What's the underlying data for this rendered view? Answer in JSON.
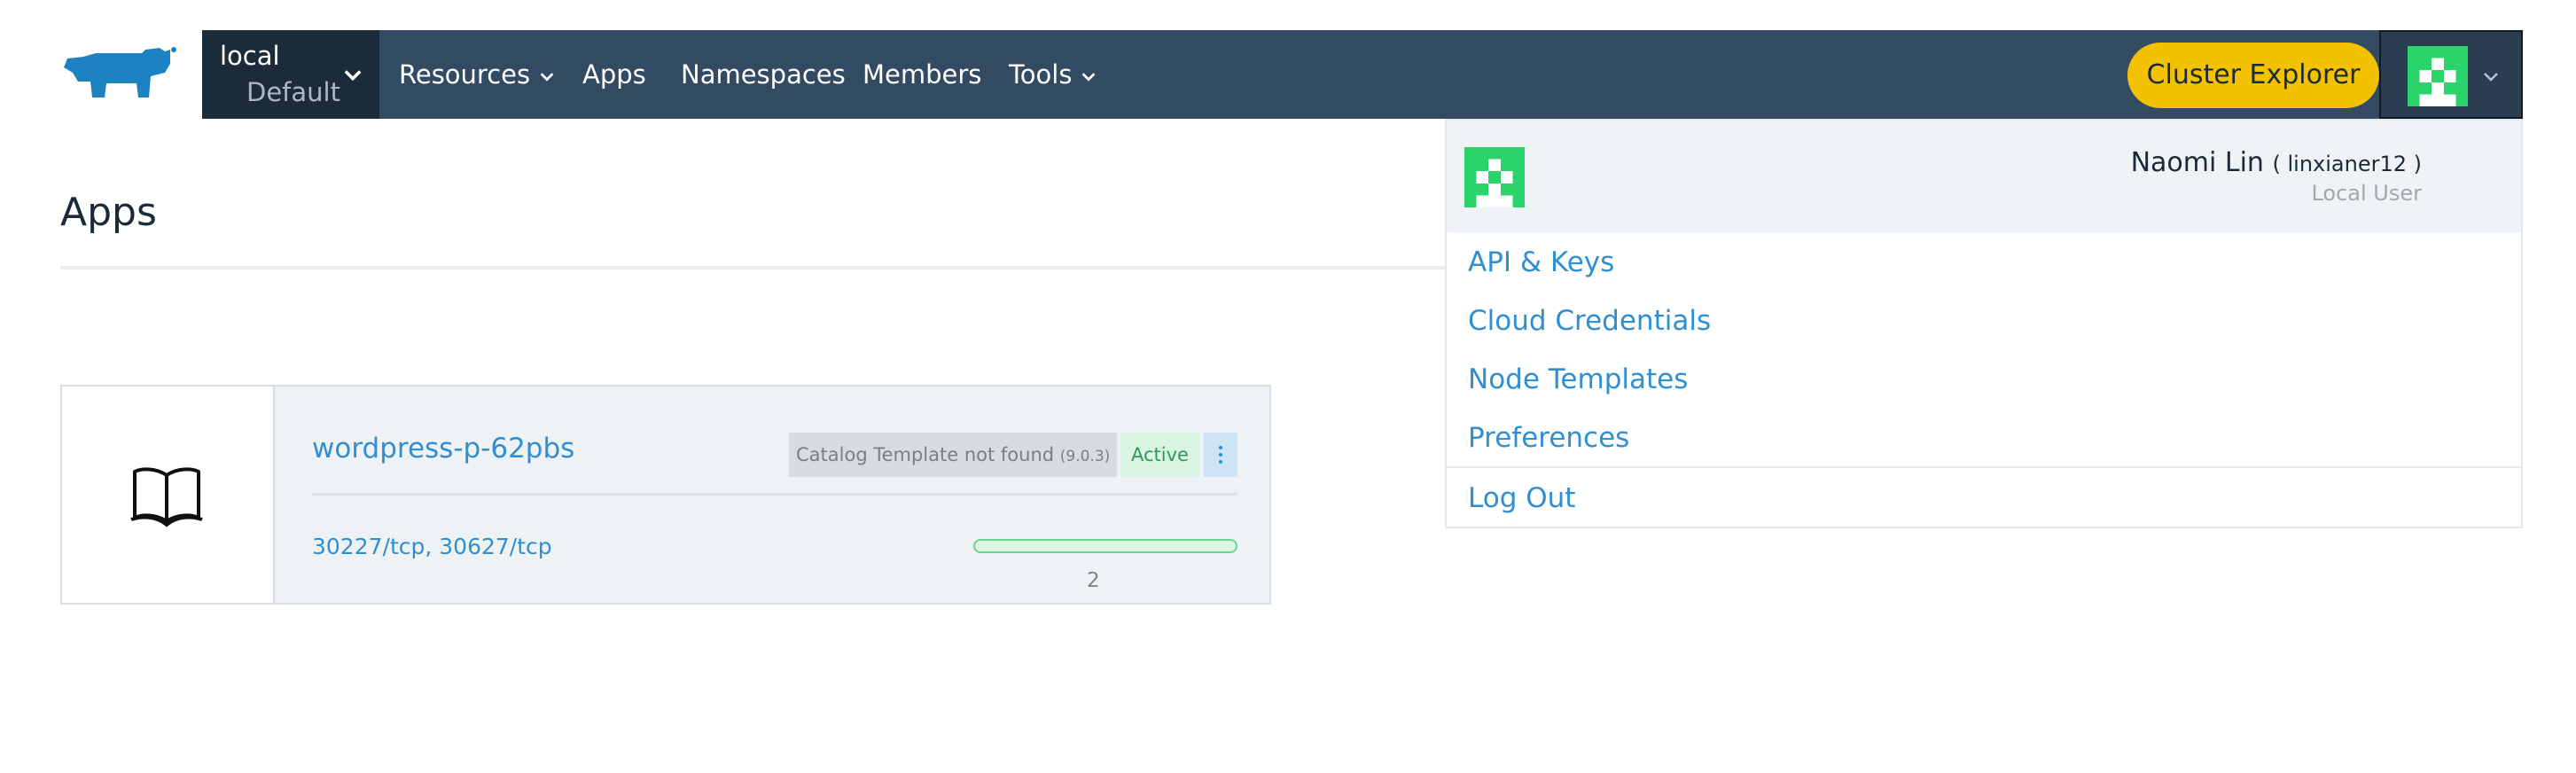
{
  "header": {
    "cluster": {
      "name": "local",
      "project": "Default"
    },
    "nav": [
      "Resources",
      "Apps",
      "Namespaces",
      "Members",
      "Tools"
    ],
    "cluster_explorer_label": "Cluster Explorer"
  },
  "page": {
    "title": "Apps"
  },
  "apps": [
    {
      "name": "wordpress-p-62pbs",
      "template_status": "Catalog Template not found",
      "template_version": "(9.0.3)",
      "state": "Active",
      "ports": [
        "30227/tcp",
        "30627/tcp"
      ],
      "port_separator": ",",
      "pod_count": "2",
      "progress": 1.0
    }
  ],
  "user_menu": {
    "display_name": "Naomi Lin",
    "username": "( linxianer12 )",
    "role": "Local User",
    "items": [
      "API & Keys",
      "Cloud Credentials",
      "Node Templates",
      "Preferences"
    ],
    "logout": "Log Out"
  },
  "colors": {
    "header_bg": "#334a63",
    "accent_yellow": "#f2c100",
    "link_blue": "#2f8fd0",
    "active_green": "#2d9a55",
    "avatar_green": "#2ad46b"
  }
}
